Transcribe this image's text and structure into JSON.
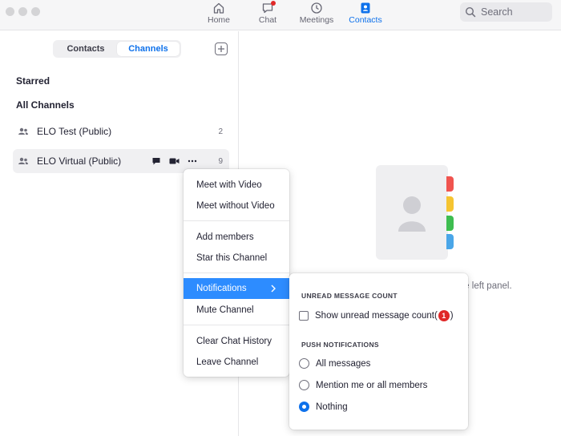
{
  "nav": {
    "tabs": [
      {
        "label": "Home",
        "icon": "home-icon"
      },
      {
        "label": "Chat",
        "icon": "chat-icon"
      },
      {
        "label": "Meetings",
        "icon": "clock-icon"
      },
      {
        "label": "Contacts",
        "icon": "contacts-icon"
      }
    ],
    "active_tab": "Contacts",
    "search_placeholder": "Search"
  },
  "sidebar": {
    "segments": [
      "Contacts",
      "Channels"
    ],
    "active_segment": "Channels",
    "starred_label": "Starred",
    "all_channels_label": "All Channels",
    "channels": [
      {
        "name": "ELO Test (Public)",
        "count": "2"
      },
      {
        "name": "ELO Virtual (Public)",
        "count": "9"
      }
    ]
  },
  "empty_state": {
    "hint_text": "n the left panel."
  },
  "context_menu": {
    "items": [
      "Meet with Video",
      "Meet without Video",
      "Add members",
      "Star this Channel",
      "Notifications",
      "Mute Channel",
      "Clear Chat History",
      "Leave Channel"
    ],
    "selected": "Notifications"
  },
  "notifications_submenu": {
    "unread_heading": "UNREAD MESSAGE COUNT",
    "show_unread_label": "Show unread message count(",
    "show_unread_badge": "1",
    "show_unread_suffix": ")",
    "show_unread_checked": false,
    "push_heading": "PUSH NOTIFICATIONS",
    "options": [
      "All messages",
      "Mention me or all members",
      "Nothing"
    ],
    "selected_option": "Nothing"
  },
  "colors": {
    "accent": "#0e71eb",
    "menu_highlight": "#2d8cff",
    "badge": "#e02828",
    "tab_red": "#f0544f",
    "tab_yellow": "#f5c431",
    "tab_green": "#3ebd50",
    "tab_blue": "#4aa6e8"
  }
}
